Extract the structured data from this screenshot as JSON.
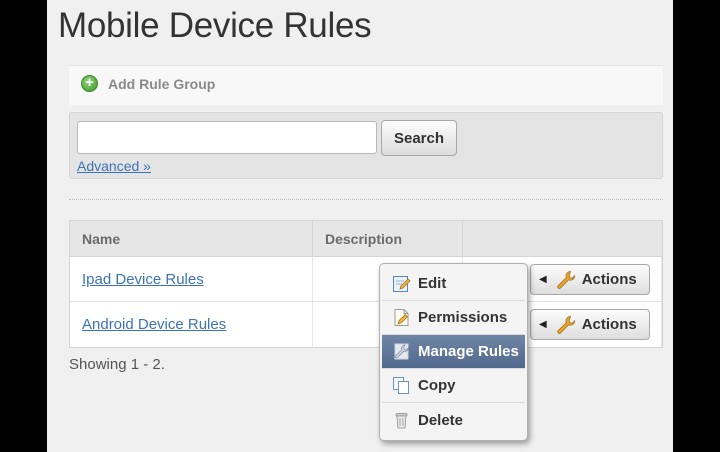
{
  "page": {
    "title": "Mobile Device Rules"
  },
  "toolbar": {
    "add_label": "Add Rule Group",
    "add_icon": "add-circle-icon"
  },
  "search": {
    "value": "",
    "placeholder": "",
    "button_label": "Search",
    "advanced_label": "Advanced »"
  },
  "table": {
    "columns": [
      "Name",
      "Description",
      ""
    ],
    "rows": [
      {
        "name": "Ipad Device Rules",
        "description": "",
        "actions_label": "Actions"
      },
      {
        "name": "Android Device Rules",
        "description": "",
        "actions_label": "Actions"
      }
    ]
  },
  "pagination": {
    "showing": "Showing 1 - 2."
  },
  "actions_menu": {
    "items": [
      {
        "label": "Edit",
        "icon": "edit-icon"
      },
      {
        "label": "Permissions",
        "icon": "permissions-icon"
      },
      {
        "label": "Manage Rules",
        "icon": "manage-rules-icon",
        "active": true
      },
      {
        "label": "Copy",
        "icon": "copy-icon"
      },
      {
        "label": "Delete",
        "icon": "delete-icon"
      }
    ]
  },
  "colors": {
    "link": "#3b73b9",
    "menu_active": "#5d7497",
    "add_icon": "#4ea536",
    "wrench": "#e0a020"
  }
}
